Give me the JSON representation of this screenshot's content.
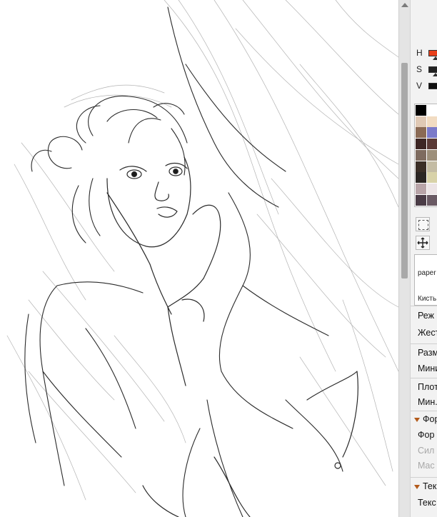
{
  "color_panel": {
    "h_label": "H",
    "s_label": "S",
    "v_label": "V",
    "swatches": [
      "#000000",
      "#ffffff",
      "#e0c9b5",
      "#f2dcc2",
      "#8a6a55",
      "#7b7ac9",
      "#3d2624",
      "#5a3a36",
      "#7e6b5f",
      "#9d8f7a",
      "#3a2e26",
      "#c4bca4",
      "#2b2623",
      "#d8d2a8",
      "#b8a4a8",
      "#ece4e6",
      "#4a3c46",
      "#6a5a64"
    ],
    "accent": "#e8401c"
  },
  "brush": {
    "name": "paper",
    "label": "Кисть"
  },
  "properties": {
    "mode": "Реж",
    "gesture": "Жест",
    "size": "Разме",
    "min_size": "Мини",
    "density": "Плот",
    "min_density": "Мин.",
    "form_section": "Фор",
    "form": "Фор",
    "strength": "Сил",
    "scale": "Mac",
    "texture_section": "Тек",
    "texture": "Текс"
  }
}
